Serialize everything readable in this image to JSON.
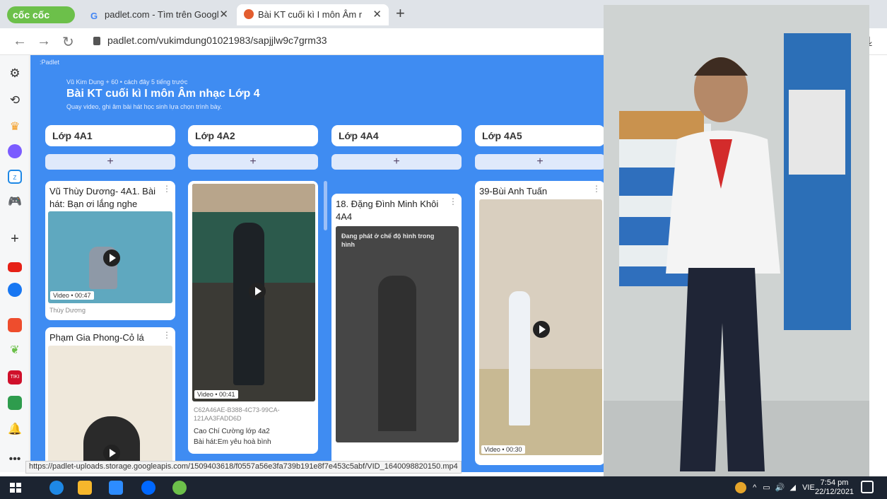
{
  "browser": {
    "brand": "cốc cốc",
    "tabs": [
      {
        "title": "padlet.com - Tìm trên Googl",
        "active": false
      },
      {
        "title": "Bài KT cuối kì I môn Âm r",
        "active": true
      }
    ],
    "new_tab": "+",
    "url": "padlet.com/vukimdung01021983/sapjjlw9c7grm33",
    "status_url": "https://padlet-uploads.storage.googleapis.com/1509403618/f0557a56e3fa739b191e8f7e453c5abf/VID_1640098820150.mp4"
  },
  "padlet": {
    "logo": ":Padlet",
    "author_line": "Vũ Kim Dung + 60 • cách đây 5 tiếng trước",
    "title": "Bài KT cuối kì I môn Âm nhạc Lớp 4",
    "description": "Quay video, ghi âm bài hát học sinh lựa chọn trình bày.",
    "add_label": "+",
    "columns": [
      {
        "name": "Lớp 4A1"
      },
      {
        "name": "Lớp 4A2"
      },
      {
        "name": "Lớp 4A4"
      },
      {
        "name": "Lớp 4A5"
      }
    ],
    "cards": {
      "c1": {
        "title": "Vũ Thùy Dương- 4A1. Bài hát: Bạn ơi lắng nghe",
        "meta": "Video • 00:47",
        "author": "Thùy Dương"
      },
      "c2": {
        "title": "Phạm Gia Phong-Cỏ lá"
      },
      "c3": {
        "meta": "Video • 00:41",
        "filename": "C62A46AE-B388-4C73-99CA-121AA3FADD6D",
        "body1": "Cao Chí Cường lớp 4a2",
        "body2": "Bài hát:Em yêu hoà bình"
      },
      "c4": {
        "title": "18. Đặng Đình Minh Khôi 4A4",
        "pip": "Đang phát ở chế độ hình trong hình"
      },
      "c5": {
        "title": "39-Bùi Anh Tuấn",
        "meta": "Video • 00:30"
      }
    }
  },
  "taskbar": {
    "lang": "VIE",
    "time": "7:54 pm",
    "date": "22/12/2021"
  },
  "colors": {
    "board": "#3f8cf2",
    "taskbar": "#1c2431",
    "brand": "#6cc04a"
  }
}
